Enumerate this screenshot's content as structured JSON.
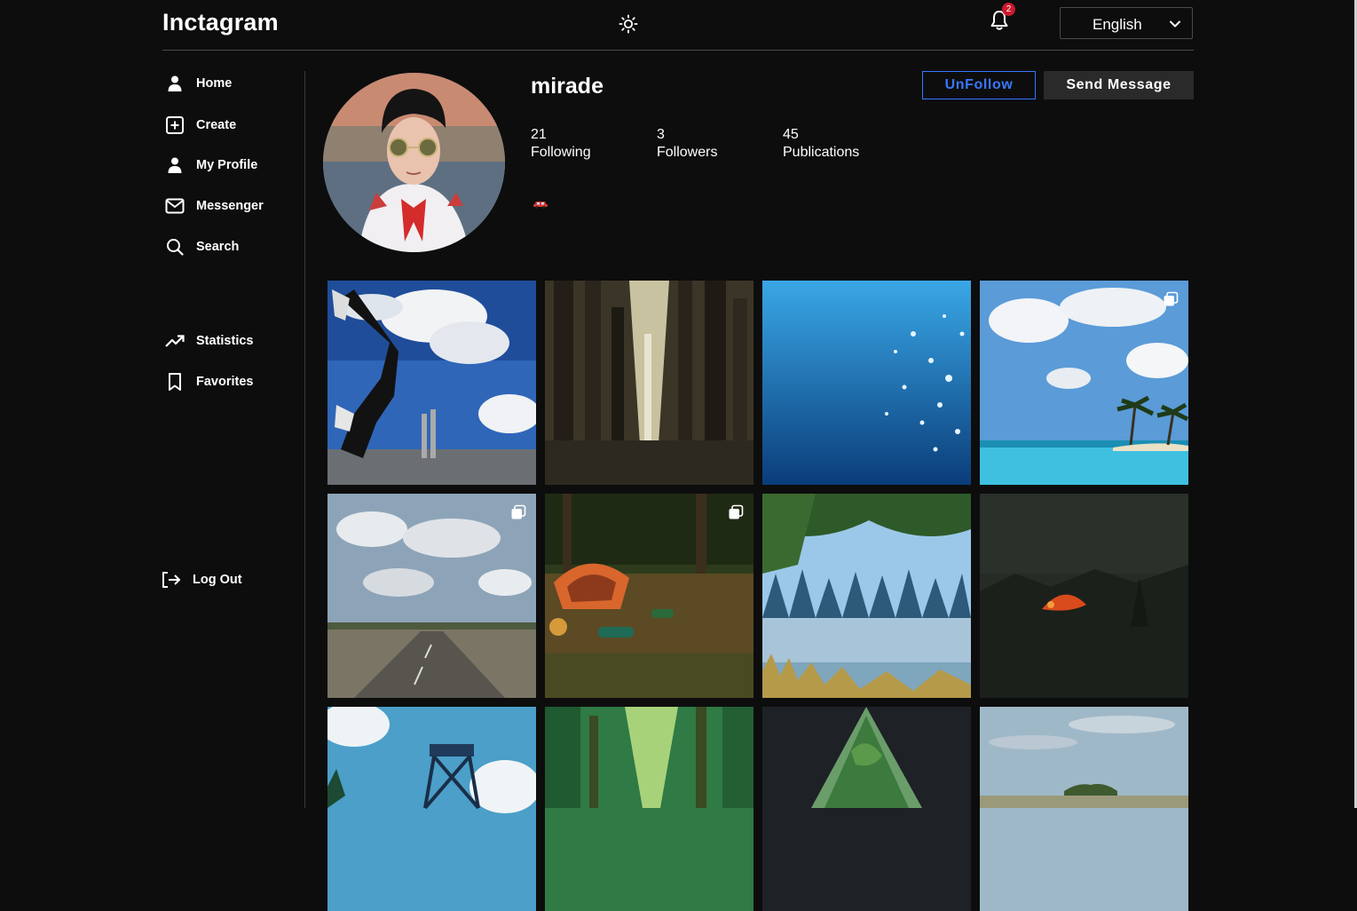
{
  "app": {
    "logo": "Inctagram"
  },
  "header": {
    "notification_count": "2",
    "language": {
      "selected": "English"
    }
  },
  "sidebar": {
    "items": [
      {
        "label": "Home",
        "icon": "person-icon"
      },
      {
        "label": "Create",
        "icon": "plus-square-icon"
      },
      {
        "label": "My Profile",
        "icon": "person-icon"
      },
      {
        "label": "Messenger",
        "icon": "mail-icon"
      },
      {
        "label": "Search",
        "icon": "search-icon"
      },
      {
        "label": "Statistics",
        "icon": "trending-up-icon"
      },
      {
        "label": "Favorites",
        "icon": "bookmark-icon"
      },
      {
        "label": "Log Out",
        "icon": "logout-icon"
      }
    ]
  },
  "profile": {
    "username": "mirade",
    "unfollow_label": "UnFollow",
    "message_label": "Send Message",
    "stats": [
      {
        "value": "21",
        "label": "Following"
      },
      {
        "value": "3",
        "label": "Followers"
      },
      {
        "value": "45",
        "label": "Publications"
      }
    ],
    "bio_emoji": "car-emoji"
  },
  "posts": [
    {
      "subject": "breakdancer on sky",
      "multi": false
    },
    {
      "subject": "forest waterfall",
      "multi": false
    },
    {
      "subject": "sparkling ocean",
      "multi": false
    },
    {
      "subject": "tropical beach",
      "multi": true
    },
    {
      "subject": "country road",
      "multi": true
    },
    {
      "subject": "campsite tent",
      "multi": true
    },
    {
      "subject": "lake forest",
      "multi": false
    },
    {
      "subject": "dark forest campfire",
      "multi": false
    },
    {
      "subject": "watch tower",
      "multi": false
    },
    {
      "subject": "sunlit forest",
      "multi": false
    },
    {
      "subject": "tent view",
      "multi": false
    },
    {
      "subject": "lake island",
      "multi": false
    }
  ],
  "colors": {
    "background": "#0d0d0d",
    "accent_blue": "#3877ff",
    "badge_red": "#cc1a2d",
    "divider": "#4a4a4a"
  }
}
